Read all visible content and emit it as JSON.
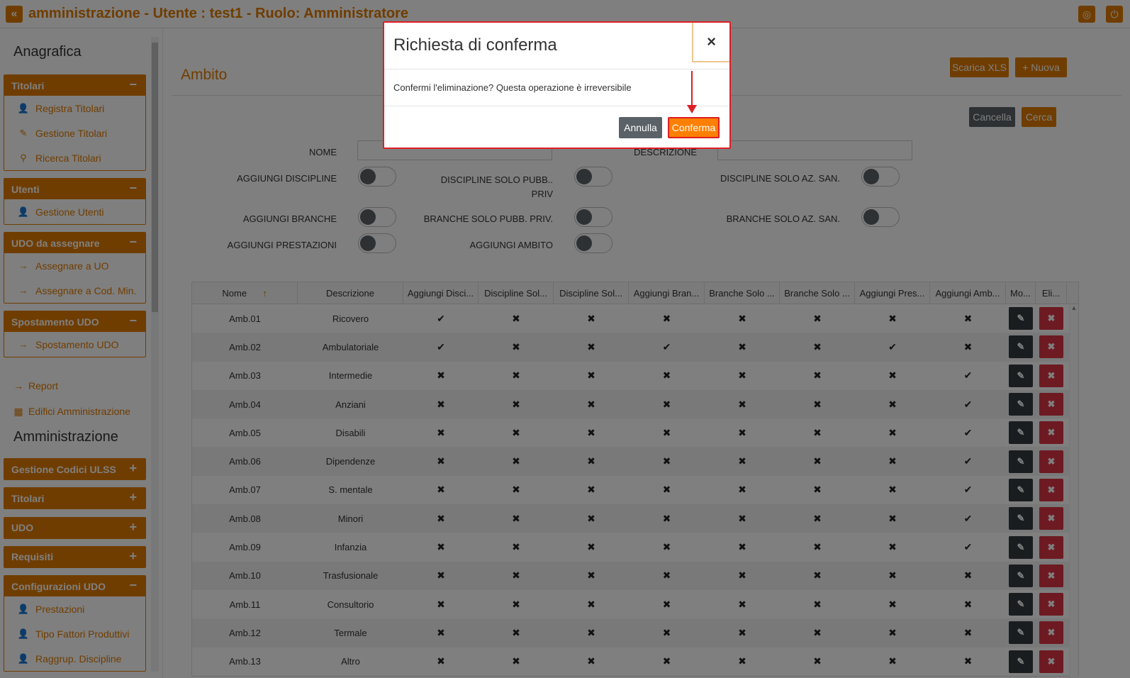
{
  "app": {
    "title": "amministrazione - Utente : test1 - Ruolo: Amministratore",
    "collapse_icon": "«",
    "globe_icon": "◎",
    "power_icon": "⏻"
  },
  "sidebar": {
    "section1_title": "Anagrafica",
    "section2_title": "Amministrazione",
    "panels": [
      {
        "title": "Titolari",
        "toggle": "−",
        "items": [
          {
            "label": "Registra Titolari",
            "icon": "user-plus-icon",
            "glyph": "👤"
          },
          {
            "label": "Gestione Titolari",
            "icon": "edit-icon",
            "glyph": "✎"
          },
          {
            "label": "Ricerca Titolari",
            "icon": "search-icon",
            "glyph": "⚲"
          }
        ]
      },
      {
        "title": "Utenti",
        "toggle": "−",
        "items": [
          {
            "label": "Gestione Utenti",
            "icon": "user-icon",
            "glyph": "👤"
          }
        ]
      },
      {
        "title": "UDO da assegnare",
        "toggle": "−",
        "items": [
          {
            "label": "Assegnare a UO",
            "icon": "arrow-right-icon",
            "glyph": "→"
          },
          {
            "label": "Assegnare a Cod. Min.",
            "icon": "arrow-right-icon",
            "glyph": "→"
          }
        ]
      },
      {
        "title": "Spostamento UDO",
        "toggle": "−",
        "items": [
          {
            "label": "Spostamento UDO",
            "icon": "arrow-right-icon",
            "glyph": "→"
          }
        ]
      }
    ],
    "plain_items": [
      {
        "label": "Report",
        "icon": "arrow-right-icon",
        "glyph": "→"
      },
      {
        "label": "Edifici Amministrazione",
        "icon": "building-icon",
        "glyph": "▦"
      }
    ],
    "admin_panels": [
      {
        "title": "Gestione Codici ULSS",
        "toggle": "+"
      },
      {
        "title": "Titolari",
        "toggle": "+"
      },
      {
        "title": "UDO",
        "toggle": "+"
      },
      {
        "title": "Requisiti",
        "toggle": "+"
      }
    ],
    "config_panel": {
      "title": "Configurazioni UDO",
      "toggle": "−",
      "items": [
        {
          "label": "Prestazioni",
          "icon": "user-icon",
          "glyph": "👤"
        },
        {
          "label": "Tipo Fattori Produttivi",
          "icon": "user-icon",
          "glyph": "👤"
        },
        {
          "label": "Raggrup. Discipline",
          "icon": "user-icon",
          "glyph": "👤"
        }
      ]
    }
  },
  "main": {
    "page_title": "Ambito",
    "btn_xls": "Scarica XLS",
    "btn_new": "+ Nuova",
    "btn_cancel": "Cancella",
    "btn_search": "Cerca",
    "filters": {
      "nome": "NOME",
      "descrizione": "DESCRIZIONE",
      "agg_discipline": "AGGIUNGI DISCIPLINE",
      "disc_pubb_priv": "DISCIPLINE SOLO PUBB.. PRIV",
      "disc_az_san": "DISCIPLINE SOLO AZ. SAN.",
      "agg_branche": "AGGIUNGI BRANCHE",
      "branche_pubb_priv": "BRANCHE SOLO PUBB. PRIV.",
      "branche_az_san": "BRANCHE SOLO AZ. SAN.",
      "agg_prestazioni": "AGGIUNGI PRESTAZIONI",
      "agg_ambito": "AGGIUNGI AMBITO"
    },
    "table": {
      "headers": [
        "Nome",
        "Descrizione",
        "Aggiungi Disci...",
        "Discipline Sol...",
        "Discipline Sol...",
        "Aggiungi Bran...",
        "Branche Solo ...",
        "Branche Solo ...",
        "Aggiungi Pres...",
        "Aggiungi Amb...",
        "Mo...",
        "Eli..."
      ],
      "sort_icon": "↑",
      "rows": [
        {
          "nome": "Amb.01",
          "desc": "Ricovero",
          "flags": [
            1,
            0,
            0,
            0,
            0,
            0,
            0,
            0
          ]
        },
        {
          "nome": "Amb.02",
          "desc": "Ambulatoriale",
          "flags": [
            1,
            0,
            0,
            1,
            0,
            0,
            1,
            0
          ]
        },
        {
          "nome": "Amb.03",
          "desc": "Intermedie",
          "flags": [
            0,
            0,
            0,
            0,
            0,
            0,
            0,
            1
          ]
        },
        {
          "nome": "Amb.04",
          "desc": "Anziani",
          "flags": [
            0,
            0,
            0,
            0,
            0,
            0,
            0,
            1
          ]
        },
        {
          "nome": "Amb.05",
          "desc": "Disabili",
          "flags": [
            0,
            0,
            0,
            0,
            0,
            0,
            0,
            1
          ]
        },
        {
          "nome": "Amb.06",
          "desc": "Dipendenze",
          "flags": [
            0,
            0,
            0,
            0,
            0,
            0,
            0,
            1
          ]
        },
        {
          "nome": "Amb.07",
          "desc": "S. mentale",
          "flags": [
            0,
            0,
            0,
            0,
            0,
            0,
            0,
            1
          ]
        },
        {
          "nome": "Amb.08",
          "desc": "Minori",
          "flags": [
            0,
            0,
            0,
            0,
            0,
            0,
            0,
            1
          ]
        },
        {
          "nome": "Amb.09",
          "desc": "Infanzia",
          "flags": [
            0,
            0,
            0,
            0,
            0,
            0,
            0,
            1
          ]
        },
        {
          "nome": "Amb.10",
          "desc": "Trasfusionale",
          "flags": [
            0,
            0,
            0,
            0,
            0,
            0,
            0,
            0
          ]
        },
        {
          "nome": "Amb.11",
          "desc": "Consultorio",
          "flags": [
            0,
            0,
            0,
            0,
            0,
            0,
            0,
            0
          ]
        },
        {
          "nome": "Amb.12",
          "desc": "Termale",
          "flags": [
            0,
            0,
            0,
            0,
            0,
            0,
            0,
            0
          ]
        },
        {
          "nome": "Amb.13",
          "desc": "Altro",
          "flags": [
            0,
            0,
            0,
            0,
            0,
            0,
            0,
            0
          ]
        }
      ],
      "check_glyph": "✔",
      "cross_glyph": "✖",
      "edit_glyph": "✎",
      "delete_glyph": "✖"
    }
  },
  "modal": {
    "title": "Richiesta di conferma",
    "close": "×",
    "message": "Confermi l'eliminazione? Questa operazione è irreversibile",
    "cancel": "Annulla",
    "confirm": "Conferma"
  },
  "colors": {
    "accent": "#e07b00",
    "danger": "#dc3545",
    "dark": "#343a40",
    "highlight": "#dc1f26"
  }
}
